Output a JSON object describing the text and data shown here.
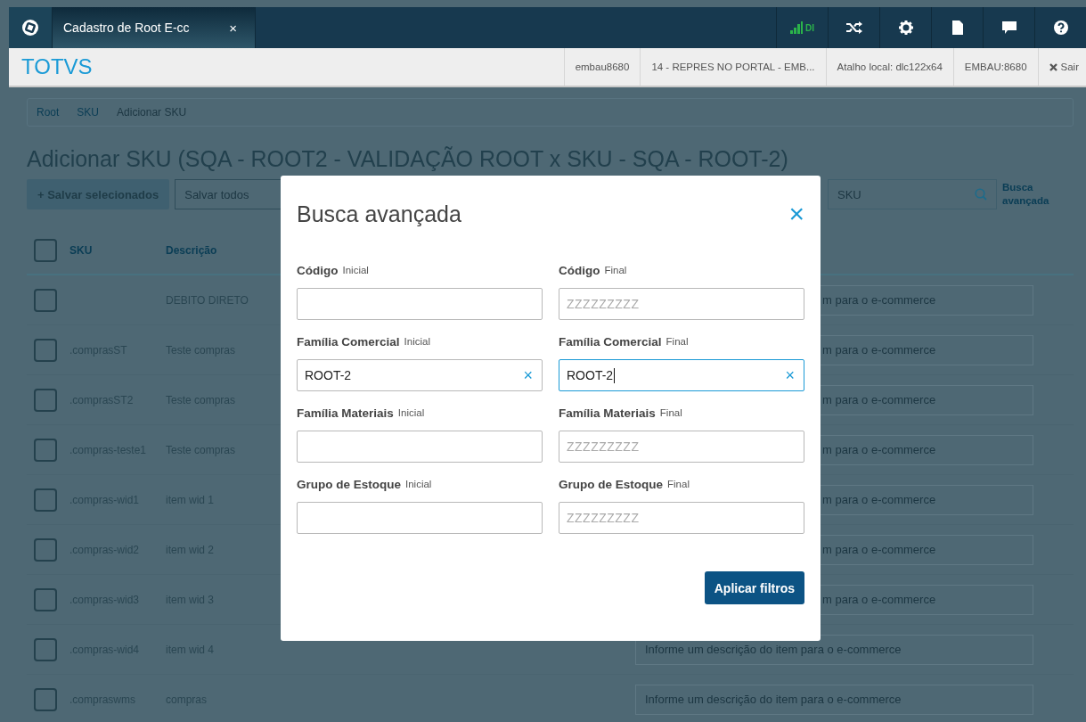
{
  "tab": {
    "title": "Cadastro de Root E-cc",
    "close": "×",
    "selected": true
  },
  "toolbar": {
    "signal_label": "DI"
  },
  "app_bar": {
    "logo": "TOTVS",
    "info": [
      "embau8680",
      "14 - REPRES NO PORTAL - EMB...",
      "Atalho local: dlc122x64",
      "EMBAU:8680"
    ],
    "logout": "Sair"
  },
  "breadcrumb": [
    "Root",
    "SKU",
    "Adicionar SKU"
  ],
  "page_title": "Adicionar SKU (SQA - ROOT2 - VALIDAÇÃO ROOT x SKU - SQA - ROOT-2)",
  "actions": {
    "save_selected": "+ Salvar selecionados",
    "save_all": "Salvar todos",
    "search_placeholder": "SKU",
    "advanced_link": "Busca avançada"
  },
  "table": {
    "columns": [
      "SKU",
      "Descrição"
    ],
    "header_checked": false,
    "rows": [
      {
        "checked": false,
        "description": "DEBITO DIRETO",
        "field_placeholder": "m para o e-commerce",
        "partly_hidden": true
      },
      {
        "checked": false,
        "sku": ".comprasST",
        "description": "Teste compras",
        "field_placeholder": "m para o e-commerce",
        "partly_hidden": true
      },
      {
        "checked": false,
        "sku": ".comprasST2",
        "description": "Teste compras",
        "field_placeholder": "m para o e-commerce",
        "partly_hidden": true
      },
      {
        "checked": false,
        "sku": ".compras-teste1",
        "description": "Teste compras",
        "field_placeholder": "m para o e-commerce",
        "partly_hidden": true
      },
      {
        "checked": false,
        "sku": ".compras-wid1",
        "description": "item wid 1",
        "field_placeholder": "m para o e-commerce",
        "partly_hidden": true
      },
      {
        "checked": false,
        "sku": ".compras-wid2",
        "description": "item wid 2",
        "field_placeholder": "m para o e-commerce",
        "partly_hidden": true
      },
      {
        "checked": false,
        "sku": ".compras-wid3",
        "description": "item wid 3",
        "field_placeholder": "m para o e-commerce",
        "partly_hidden": true
      },
      {
        "checked": false,
        "sku": ".compras-wid4",
        "description": "item wid 4",
        "field_placeholder": "Informe um descrição do item para o e-commerce",
        "partly_hidden": false
      },
      {
        "checked": false,
        "sku": ".compraswms",
        "description": "compras",
        "field_placeholder": "Informe um descrição do item para o e-commerce",
        "partly_hidden": false
      }
    ]
  },
  "modal": {
    "title": "Busca avançada",
    "close": "×",
    "fields": [
      {
        "label": "Código",
        "sublabel": "Inicial",
        "focused": false
      },
      {
        "label": "Código",
        "sublabel": "Final",
        "placeholder": "ZZZZZZZZZ",
        "focused": false
      },
      {
        "label": "Família Comercial",
        "sublabel": "Inicial",
        "value": "ROOT-2",
        "clear": "×",
        "focused": false
      },
      {
        "label": "Família Comercial",
        "sublabel": "Final",
        "value": "ROOT-2",
        "clear": "×",
        "focused": true
      },
      {
        "label": "Família Materiais",
        "sublabel": "Inicial",
        "focused": false
      },
      {
        "label": "Família Materiais",
        "sublabel": "Final",
        "placeholder": "ZZZZZZZZZ",
        "focused": false
      },
      {
        "label": "Grupo de Estoque",
        "sublabel": "Inicial",
        "focused": false
      },
      {
        "label": "Grupo de Estoque",
        "sublabel": "Final",
        "placeholder": "ZZZZZZZZZ",
        "focused": false
      }
    ],
    "apply": "Aplicar filtros"
  }
}
